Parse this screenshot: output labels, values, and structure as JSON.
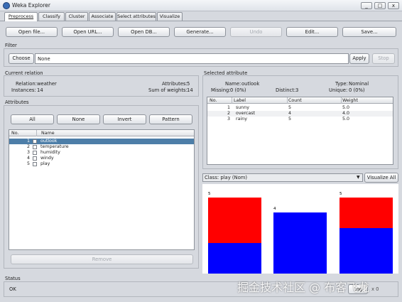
{
  "window": {
    "title": "Weka Explorer",
    "min": "_",
    "max": "□",
    "close": "x"
  },
  "tabs": [
    "Preprocess",
    "Classify",
    "Cluster",
    "Associate",
    "Select attributes",
    "Visualize"
  ],
  "toolbar": [
    "Open file...",
    "Open URL...",
    "Open DB...",
    "Generate...",
    "Undo",
    "Edit...",
    "Save..."
  ],
  "filter": {
    "section": "Filter",
    "choose": "Choose",
    "value": "None",
    "apply": "Apply",
    "stop": "Stop"
  },
  "current_relation": {
    "section": "Current relation",
    "relation_label": "Relation:",
    "relation": "weather",
    "instances_label": "Instances:",
    "instances": "14",
    "attributes_label": "Attributes:",
    "attributes": "5",
    "sum_weights_label": "Sum of weights:",
    "sum_weights": "14"
  },
  "attributes": {
    "section": "Attributes",
    "buttons": [
      "All",
      "None",
      "Invert",
      "Pattern"
    ],
    "col_no": "No.",
    "col_name": "Name",
    "rows": [
      {
        "no": "1",
        "name": "outlook"
      },
      {
        "no": "2",
        "name": "temperature"
      },
      {
        "no": "3",
        "name": "humidity"
      },
      {
        "no": "4",
        "name": "windy"
      },
      {
        "no": "5",
        "name": "play"
      }
    ],
    "remove": "Remove"
  },
  "selected_attribute": {
    "section": "Selected attribute",
    "name_label": "Name:",
    "name": "outlook",
    "type_label": "Type:",
    "type": "Nominal",
    "missing_label": "Missing:",
    "missing": "0 (0%)",
    "distinct_label": "Distinct:",
    "distinct": "3",
    "unique_label": "Unique:",
    "unique": "0 (0%)",
    "cols": [
      "No.",
      "Label",
      "Count",
      "Weight"
    ],
    "rows": [
      {
        "no": "1",
        "label": "sunny",
        "count": "5",
        "weight": "5.0"
      },
      {
        "no": "2",
        "label": "overcast",
        "count": "4",
        "weight": "4.0"
      },
      {
        "no": "3",
        "label": "rainy",
        "count": "5",
        "weight": "5.0"
      }
    ]
  },
  "class_select": {
    "value": "Class: play (Nom)",
    "arrow": "▼",
    "visualize_all": "Visualize All"
  },
  "chart_data": {
    "type": "bar",
    "categories": [
      "sunny",
      "overcast",
      "rainy"
    ],
    "totals": [
      5,
      4,
      5
    ],
    "series": [
      {
        "values": [
          3,
          0,
          2
        ],
        "color": "#ff0000"
      },
      {
        "values": [
          2,
          4,
          3
        ],
        "color": "#0000ff"
      }
    ],
    "ylim": [
      0,
      5
    ]
  },
  "status": {
    "section": "Status",
    "text": "OK",
    "log": "Log",
    "x_count": "x 0"
  },
  "watermark": "掘金技术社区 @ 布客飞龙"
}
